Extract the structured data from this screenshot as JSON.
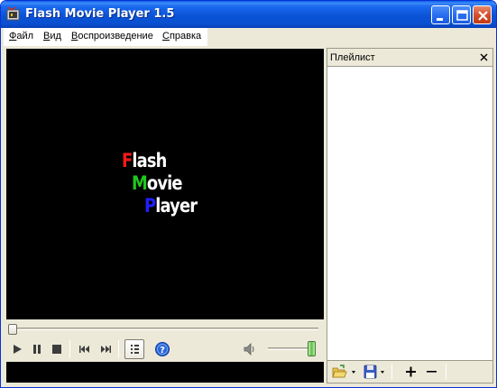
{
  "window": {
    "title": "Flash Movie Player 1.5"
  },
  "menu": {
    "file": {
      "accel": "Ф",
      "rest": "айл"
    },
    "view": {
      "accel": "В",
      "rest": "ид"
    },
    "playback": {
      "accel": "В",
      "rest": "оспроизведение"
    },
    "help": {
      "accel": "С",
      "rest": "правка"
    }
  },
  "logo": {
    "line1": {
      "first": "F",
      "rest": "lash",
      "first_color": "#ff1a1a"
    },
    "line2": {
      "first": "M",
      "rest": "ovie",
      "first_color": "#1ec81e"
    },
    "line3": {
      "first": "P",
      "rest": "layer",
      "first_color": "#2020ff"
    }
  },
  "controls": {
    "seek_position": 0,
    "volume_level": 1.0,
    "icons": [
      "play-icon",
      "pause-icon",
      "stop-icon",
      "previous-icon",
      "next-icon",
      "playlist-icon",
      "help-icon",
      "speaker-icon"
    ]
  },
  "playlist": {
    "title": "Плейлист",
    "close_glyph": "✕",
    "items": [],
    "toolbar_icons": [
      "open-folder-icon",
      "save-icon",
      "add-icon",
      "remove-icon"
    ]
  },
  "colors": {
    "titlebar": "#0a53d6",
    "window_bg": "#ece9d8",
    "video_bg": "#000000"
  }
}
